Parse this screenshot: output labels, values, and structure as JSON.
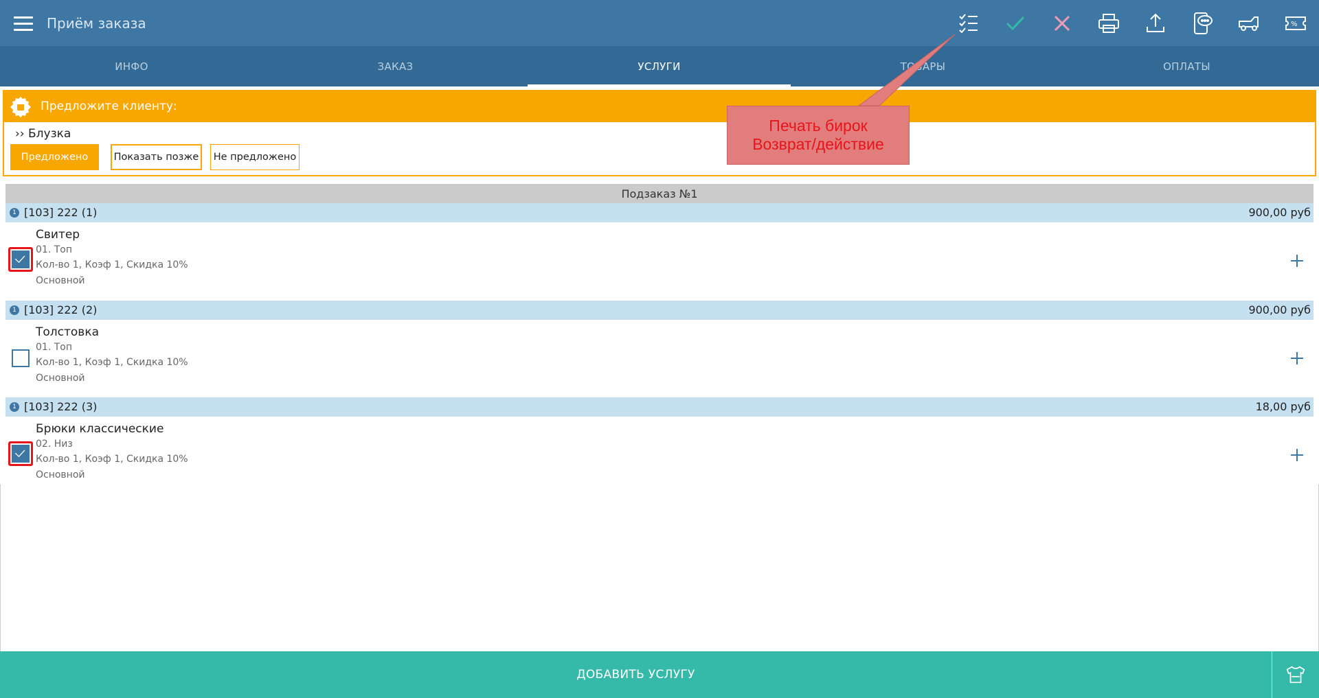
{
  "header": {
    "title": "Приём заказа",
    "icons": [
      "checklist-icon",
      "check-icon",
      "close-icon",
      "print-icon",
      "upload-icon",
      "phone-message-icon",
      "car-icon",
      "discount-ticket-icon"
    ],
    "colors": {
      "bar": "#3e77a3",
      "check": "#35baa9",
      "close": "#f29bb6"
    }
  },
  "tabs": [
    {
      "label": "ИНФО",
      "active": false
    },
    {
      "label": "ЗАКАЗ",
      "active": false
    },
    {
      "label": "УСЛУГИ",
      "active": true
    },
    {
      "label": "ТОВАРЫ",
      "active": false
    },
    {
      "label": "ОПЛАТЫ",
      "active": false
    }
  ],
  "suggestion": {
    "title": "Предложите клиенту:",
    "item": "›› Блузка",
    "buttons": {
      "offered": "Предложено",
      "later": "Показать позже",
      "not_offered": "Не предложено"
    }
  },
  "suborder": {
    "title": "Подзаказ №1"
  },
  "groups": [
    {
      "label": "[103] 222 (1)",
      "price": "900,00 руб",
      "item": {
        "name": "Свитер",
        "category": "01. Топ",
        "details": "Кол-во 1, Коэф 1, Скидка 10%",
        "type": "Основной",
        "checked": true
      }
    },
    {
      "label": "[103] 222 (2)",
      "price": "900,00 руб",
      "item": {
        "name": "Толстовка",
        "category": "01. Топ",
        "details": "Кол-во 1, Коэф 1, Скидка 10%",
        "type": "Основной",
        "checked": false
      }
    },
    {
      "label": "[103] 222 (3)",
      "price": "18,00 руб",
      "item": {
        "name": "Брюки классические",
        "category": "02. Низ",
        "details": "Кол-во 1, Коэф 1, Скидка 10%",
        "type": "Основной",
        "checked": true
      }
    }
  ],
  "bottom": {
    "add_label": "ДОБАВИТЬ УСЛУГУ",
    "icon": "shirt-icon"
  },
  "annotation": {
    "line1": "Печать бирок",
    "line2": "Возврат/действие"
  }
}
